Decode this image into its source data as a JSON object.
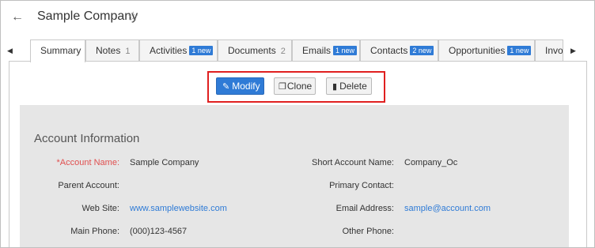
{
  "header": {
    "back_icon": "arrow-left-icon",
    "title": "Sample Company",
    "star_icon": "star-outline-icon"
  },
  "tabs": [
    {
      "label": "Summary",
      "count": "",
      "badge": ""
    },
    {
      "label": "Notes",
      "count": "1",
      "badge": ""
    },
    {
      "label": "Activities",
      "count": "",
      "badge": "1 new"
    },
    {
      "label": "Documents",
      "count": "2",
      "badge": ""
    },
    {
      "label": "Emails",
      "count": "",
      "badge": "1 new"
    },
    {
      "label": "Contacts",
      "count": "",
      "badge": "2 new"
    },
    {
      "label": "Opportunities",
      "count": "",
      "badge": "1 new"
    },
    {
      "label": "Invoi",
      "count": "",
      "badge": ""
    }
  ],
  "actions": {
    "modify": "Modify",
    "clone": "Clone",
    "delete": "Delete"
  },
  "account_info": {
    "title": "Account Information",
    "fields": {
      "account_name_label": "*Account Name:",
      "account_name_value": "Sample Company",
      "short_name_label": "Short Account Name:",
      "short_name_value": "Company_Oc",
      "parent_account_label": "Parent Account:",
      "parent_account_value": "",
      "primary_contact_label": "Primary Contact:",
      "primary_contact_value": "",
      "website_label": "Web Site:",
      "website_value": "www.samplewebsite.com",
      "email_label": "Email Address:",
      "email_value": "sample@account.com",
      "main_phone_label": "Main Phone:",
      "main_phone_value": "(000)123-4567",
      "other_phone_label": "Other Phone:",
      "other_phone_value": ""
    }
  },
  "colors": {
    "accent": "#2f7bd6",
    "required": "#e04f4f",
    "highlight_box": "#e02020",
    "panel_bg": "#e6e6e6"
  }
}
